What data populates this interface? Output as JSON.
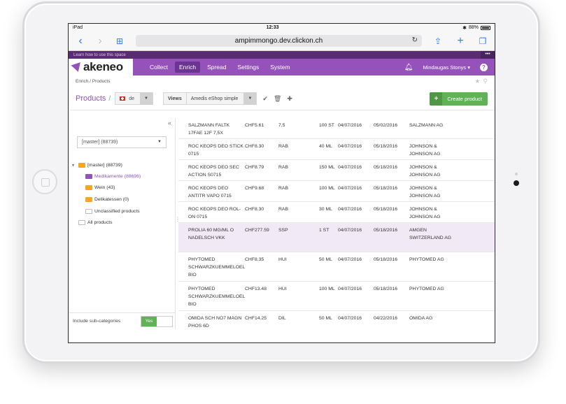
{
  "device": {
    "status": {
      "carrier": "iPad",
      "time": "12:33",
      "battery": "88%"
    },
    "url": "ampimmongo.dev.clickon.ch"
  },
  "learnbar": {
    "text": "Learn how to use this space",
    "more": "•••"
  },
  "header": {
    "brand": "akeneo",
    "menu": [
      "Collect",
      "Enrich",
      "Spread",
      "Settings",
      "System"
    ],
    "active_menu": "Enrich",
    "user": "Mindaugas Stonys ▾",
    "help": "?"
  },
  "breadcrumb": "Enrich / Products",
  "toolbar": {
    "title": "Products",
    "locale": "de",
    "views_label": "Views",
    "views_value": "Amedis eShop simple",
    "create_label": "Create product"
  },
  "sidebar": {
    "tree_select": "[master] (88739)",
    "nodes": [
      {
        "label": "[master] (88739)",
        "level": 0,
        "color": "orange",
        "expanded": true
      },
      {
        "label": "Medikamente (88696)",
        "level": 1,
        "color": "purple",
        "selected": true
      },
      {
        "label": "Wein (43)",
        "level": 1,
        "color": "orange"
      },
      {
        "label": "Delikatessen (0)",
        "level": 1,
        "color": "orange"
      },
      {
        "label": "Unclassified products",
        "level": 1,
        "color": "empty"
      },
      {
        "label": "All products",
        "level": 0,
        "color": "empty"
      }
    ],
    "subcat_label": "Include sub-categories",
    "subcat_value": "Yes"
  },
  "products": [
    {
      "name": "SALZMANN FALTK 17FAE 12F 7,5X",
      "price": "CHF5.61",
      "unit": "7,5",
      "size": "100 ST",
      "created": "04/07/2016",
      "updated": "05/02/2016",
      "supplier": "SALZMANN AG"
    },
    {
      "name": "ROC KEOPS DEO STICK 0715",
      "price": "CHF8.30",
      "unit": "RAB",
      "size": "40 ML",
      "created": "04/07/2016",
      "updated": "05/18/2016",
      "supplier": "JOHNSON & JOHNSON AG"
    },
    {
      "name": "ROC KEOPS DEO SEC ACTION S0715",
      "price": "CHF8.79",
      "unit": "RAB",
      "size": "150 ML",
      "created": "04/07/2016",
      "updated": "05/18/2016",
      "supplier": "JOHNSON & JOHNSON AG"
    },
    {
      "name": "ROC KEOPS DEO ANTITR VAPO 0715",
      "price": "CHF9.68",
      "unit": "RAB",
      "size": "100 ML",
      "created": "04/07/2016",
      "updated": "05/18/2016",
      "supplier": "JOHNSON & JOHNSON AG"
    },
    {
      "name": "ROC KEOPS DEO ROL-ON 0715",
      "price": "CHF8.30",
      "unit": "RAB",
      "size": "30 ML",
      "created": "04/07/2016",
      "updated": "05/18/2016",
      "supplier": "JOHNSON & JOHNSON AG"
    },
    {
      "name": "PROLIA 60 MG/ML O NADELSCH VKK",
      "price": "CHF277.59",
      "unit": "SSP",
      "size": "1 ST",
      "created": "04/07/2016",
      "updated": "05/18/2016",
      "supplier": "AMGEN SWITZERLAND AG",
      "highlight": true
    },
    {
      "name": "PHYTOMED SCHWARZKUEMMELOEL BIO",
      "price": "CHF8.35",
      "unit": "HUI",
      "size": "50 ML",
      "created": "04/07/2016",
      "updated": "05/18/2016",
      "supplier": "PHYTOMED AG"
    },
    {
      "name": "PHYTOMED SCHWARZKUEMMELOEL BIO",
      "price": "CHF13.48",
      "unit": "HUI",
      "size": "100 ML",
      "created": "04/07/2016",
      "updated": "05/18/2016",
      "supplier": "PHYTOMED AG"
    },
    {
      "name": "OMIDA SCH NO7 MAGN PHOS 6D",
      "price": "CHF14.25",
      "unit": "DIL",
      "size": "50 ML",
      "created": "04/07/2016",
      "updated": "04/22/2016",
      "supplier": "OMIDA AG"
    }
  ]
}
